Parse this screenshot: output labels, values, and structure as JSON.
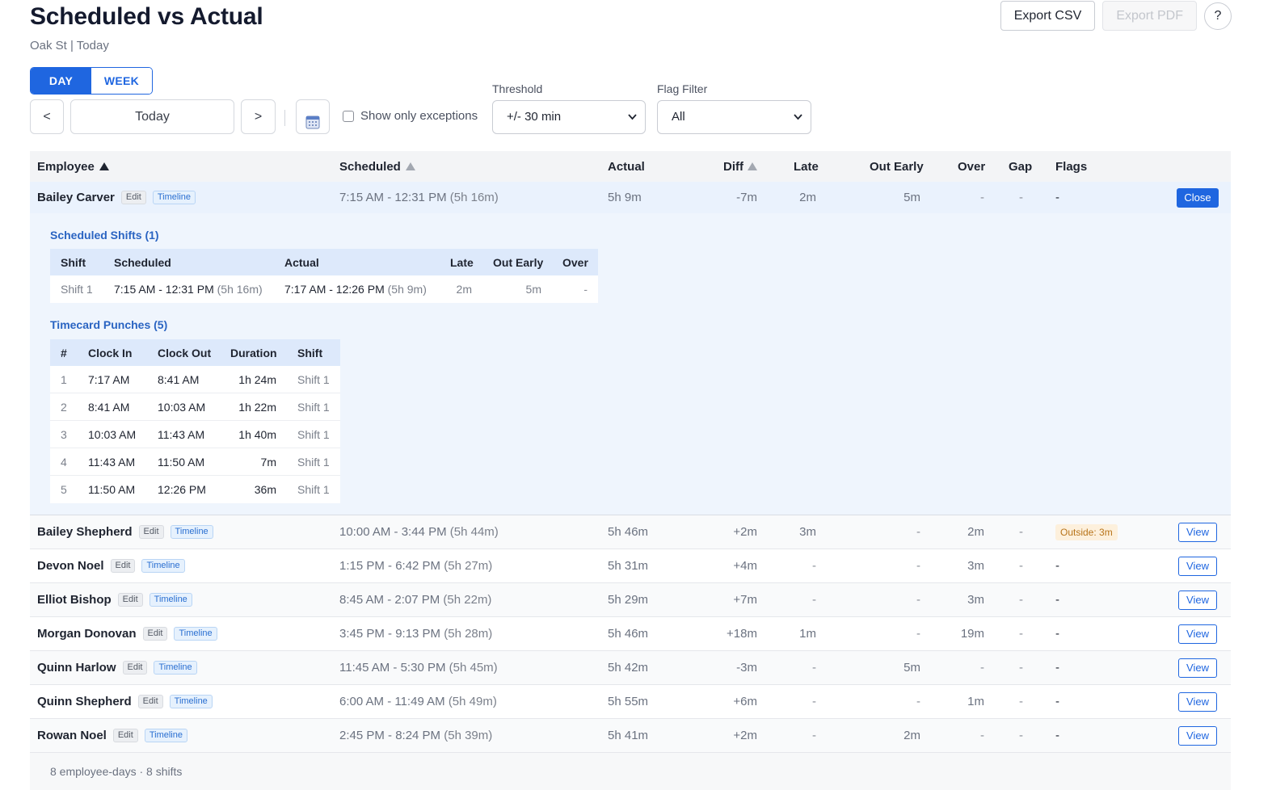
{
  "header": {
    "title": "Scheduled vs Actual",
    "subtitle": "Oak St | Today",
    "export_csv": "Export CSV",
    "export_pdf": "Export PDF",
    "help": "?"
  },
  "view_toggle": {
    "day": "DAY",
    "week": "WEEK",
    "active": "DAY"
  },
  "nav": {
    "prev": "<",
    "date": "Today",
    "next": ">"
  },
  "filters": {
    "exceptions_label": "Show only exceptions",
    "exceptions_checked": false,
    "threshold_label": "Threshold",
    "threshold_value": "+/- 30 min",
    "flag_label": "Flag Filter",
    "flag_value": "All"
  },
  "columns": {
    "employee": "Employee",
    "scheduled": "Scheduled",
    "actual": "Actual",
    "diff": "Diff",
    "late": "Late",
    "out_early": "Out Early",
    "over": "Over",
    "gap": "Gap",
    "flags": "Flags"
  },
  "row_labels": {
    "edit": "Edit",
    "timeline": "Timeline",
    "view": "View",
    "close": "Close"
  },
  "rows": [
    {
      "name": "Bailey Carver",
      "scheduled": "7:15 AM - 12:31 PM",
      "sched_dur": "(5h 16m)",
      "actual": "5h 9m",
      "diff": "-7m",
      "late": "2m",
      "out_early": "5m",
      "over": "-",
      "gap": "-",
      "flags": "-"
    },
    {
      "name": "Bailey Shepherd",
      "scheduled": "10:00 AM - 3:44 PM",
      "sched_dur": "(5h 44m)",
      "actual": "5h 46m",
      "diff": "+2m",
      "late": "3m",
      "out_early": "-",
      "over": "2m",
      "gap": "-",
      "flags": "Outside: 3m"
    },
    {
      "name": "Devon Noel",
      "scheduled": "1:15 PM - 6:42 PM",
      "sched_dur": "(5h 27m)",
      "actual": "5h 31m",
      "diff": "+4m",
      "late": "-",
      "out_early": "-",
      "over": "3m",
      "gap": "-",
      "flags": "-"
    },
    {
      "name": "Elliot Bishop",
      "scheduled": "8:45 AM - 2:07 PM",
      "sched_dur": "(5h 22m)",
      "actual": "5h 29m",
      "diff": "+7m",
      "late": "-",
      "out_early": "-",
      "over": "3m",
      "gap": "-",
      "flags": "-"
    },
    {
      "name": "Morgan Donovan",
      "scheduled": "3:45 PM - 9:13 PM",
      "sched_dur": "(5h 28m)",
      "actual": "5h 46m",
      "diff": "+18m",
      "late": "1m",
      "out_early": "-",
      "over": "19m",
      "gap": "-",
      "flags": "-"
    },
    {
      "name": "Quinn Harlow",
      "scheduled": "11:45 AM - 5:30 PM",
      "sched_dur": "(5h 45m)",
      "actual": "5h 42m",
      "diff": "-3m",
      "late": "-",
      "out_early": "5m",
      "over": "-",
      "gap": "-",
      "flags": "-"
    },
    {
      "name": "Quinn Shepherd",
      "scheduled": "6:00 AM - 11:49 AM",
      "sched_dur": "(5h 49m)",
      "actual": "5h 55m",
      "diff": "+6m",
      "late": "-",
      "out_early": "-",
      "over": "1m",
      "gap": "-",
      "flags": "-"
    },
    {
      "name": "Rowan Noel",
      "scheduled": "2:45 PM - 8:24 PM",
      "sched_dur": "(5h 39m)",
      "actual": "5h 41m",
      "diff": "+2m",
      "late": "-",
      "out_early": "2m",
      "over": "-",
      "gap": "-",
      "flags": "-"
    }
  ],
  "detail": {
    "shifts_title": "Scheduled Shifts (1)",
    "shift_cols": {
      "shift": "Shift",
      "scheduled": "Scheduled",
      "actual": "Actual",
      "late": "Late",
      "out_early": "Out Early",
      "over": "Over"
    },
    "shifts": [
      {
        "shift": "Shift 1",
        "scheduled": "7:15 AM - 12:31 PM",
        "sched_dur": "(5h 16m)",
        "actual": "7:17 AM - 12:26 PM",
        "actual_dur": "(5h 9m)",
        "late": "2m",
        "out_early": "5m",
        "over": "-"
      }
    ],
    "punches_title": "Timecard Punches (5)",
    "punch_cols": {
      "num": "#",
      "clock_in": "Clock In",
      "clock_out": "Clock Out",
      "duration": "Duration",
      "shift": "Shift"
    },
    "punches": [
      {
        "num": "1",
        "clock_in": "7:17 AM",
        "clock_out": "8:41 AM",
        "duration": "1h 24m",
        "shift": "Shift 1"
      },
      {
        "num": "2",
        "clock_in": "8:41 AM",
        "clock_out": "10:03 AM",
        "duration": "1h 22m",
        "shift": "Shift 1"
      },
      {
        "num": "3",
        "clock_in": "10:03 AM",
        "clock_out": "11:43 AM",
        "duration": "1h 40m",
        "shift": "Shift 1"
      },
      {
        "num": "4",
        "clock_in": "11:43 AM",
        "clock_out": "11:50 AM",
        "duration": "7m",
        "shift": "Shift 1"
      },
      {
        "num": "5",
        "clock_in": "11:50 AM",
        "clock_out": "12:26 PM",
        "duration": "36m",
        "shift": "Shift 1"
      }
    ]
  },
  "footer": {
    "summary": "8 employee-days · 8 shifts"
  },
  "colors": {
    "accent": "#1f66e0",
    "flag_bg": "#fdf0dc",
    "flag_text": "#b8741a",
    "expanded_bg": "#eaf2fd"
  }
}
